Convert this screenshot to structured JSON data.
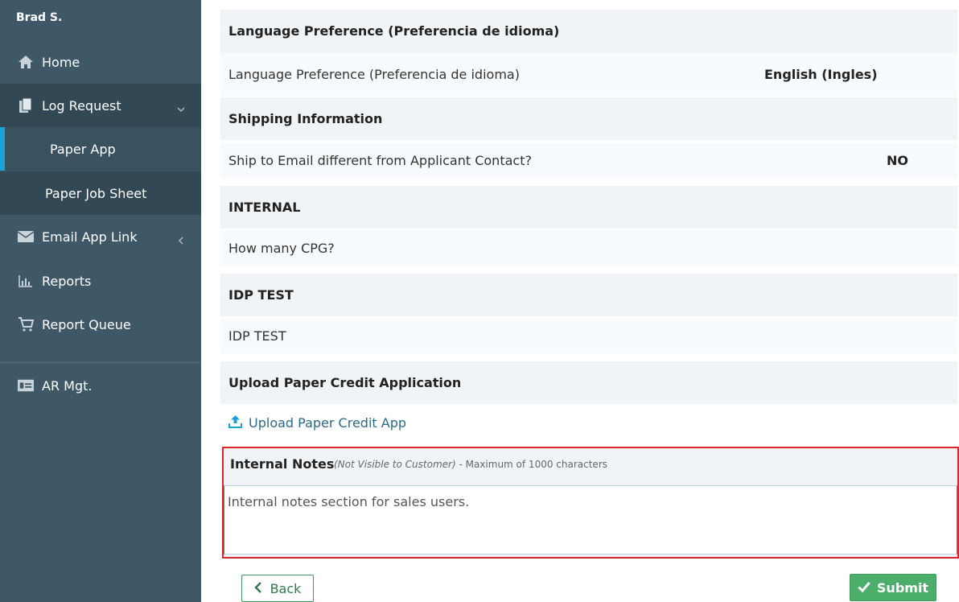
{
  "user": {
    "name": "Brad S."
  },
  "sidebar": {
    "items": [
      {
        "label": "Home",
        "icon": "home-icon"
      },
      {
        "label": "Log Request",
        "icon": "documents-icon"
      },
      {
        "label": "Paper App"
      },
      {
        "label": "Paper Job Sheet"
      },
      {
        "label": "Email App Link",
        "icon": "envelope-icon"
      },
      {
        "label": "Reports",
        "icon": "bar-chart-icon"
      },
      {
        "label": "Report Queue",
        "icon": "cart-icon"
      },
      {
        "label": "AR Mgt.",
        "icon": "id-card-icon"
      }
    ]
  },
  "sections": {
    "language_header": "Language Preference (Preferencia de idioma)",
    "language_label": "Language Preference (Preferencia de idioma)",
    "language_value": "English (Ingles)",
    "shipping_header": "Shipping Information",
    "shipping_label": "Ship to Email different from Applicant Contact?",
    "shipping_value": "NO",
    "internal_header": "INTERNAL",
    "internal_label": "How many CPG?",
    "idp_header": "IDP TEST",
    "idp_label": "IDP TEST",
    "upload_header": "Upload Paper Credit Application",
    "upload_link": "Upload Paper Credit App"
  },
  "notes": {
    "title": "Internal Notes",
    "visibility": "(Not Visible to Customer)",
    "limit": "- Maximum of 1000 characters",
    "value": "Internal notes section for sales users."
  },
  "buttons": {
    "back": "Back",
    "submit": "Submit"
  },
  "colors": {
    "sidebar": "#3e5867",
    "sidebar_dark": "#324854",
    "active_accent": "#1aa3d9",
    "highlight_border": "#d9262c",
    "submit": "#4cae6b"
  }
}
